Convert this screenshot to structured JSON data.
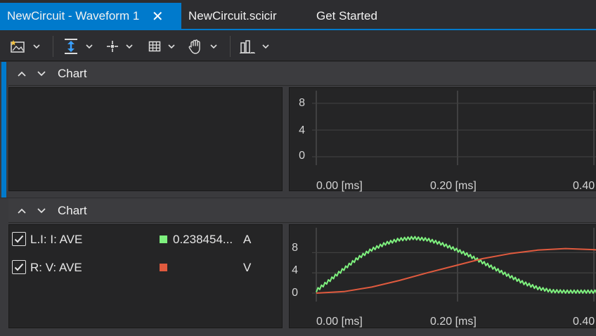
{
  "tabs": [
    {
      "label": "NewCircuit - Waveform 1",
      "active": true,
      "close": "✕"
    },
    {
      "label": "NewCircuit.scicir",
      "active": false
    },
    {
      "label": "Get Started",
      "active": false
    }
  ],
  "toolbar": {
    "icons": [
      "insert-image-icon",
      "fit-vertical-icon",
      "cursor-crosshair-icon",
      "grid-icon",
      "pan-hand-icon",
      "layout-columns-icon"
    ]
  },
  "panels": [
    {
      "title": "Chart",
      "legend": [],
      "chart_data": {
        "type": "line",
        "y_ticks": [
          "8",
          "4",
          "0"
        ],
        "x_ticks": [
          "0.00 [ms]",
          "0.20 [ms]",
          "0.40"
        ],
        "series": []
      }
    },
    {
      "title": "Chart",
      "legend": [
        {
          "name": "L.I: I: AVE",
          "checked": true,
          "color": "#7ef07e",
          "value": "0.238454...",
          "unit": "A"
        },
        {
          "name": "R: V: AVE",
          "checked": true,
          "color": "#e05a3e",
          "value": "",
          "unit": "V"
        }
      ],
      "chart_data": {
        "type": "line",
        "y_ticks": [
          "8",
          "4",
          "0"
        ],
        "x_ticks": [
          "0.00 [ms]",
          "0.20 [ms]",
          "0.40"
        ],
        "x_unit": "ms",
        "series": [
          {
            "name": "L.I: I: AVE",
            "color": "#7ef07e",
            "x": [
              0.0,
              0.02,
              0.04,
              0.06,
              0.08,
              0.1,
              0.12,
              0.14,
              0.16,
              0.18,
              0.2,
              0.22,
              0.24,
              0.26,
              0.28,
              0.3,
              0.32,
              0.34,
              0.36,
              0.38,
              0.4,
              0.42
            ],
            "y": [
              0.5,
              2.6,
              4.8,
              6.9,
              8.6,
              9.8,
              10.6,
              10.9,
              10.6,
              9.8,
              8.7,
              7.5,
              6.1,
              4.7,
              3.3,
              2.0,
              1.0,
              0.4,
              0.3,
              0.3,
              0.3,
              0.3
            ],
            "ripple": 0.6
          },
          {
            "name": "R: V: AVE",
            "color": "#e05a3e",
            "x": [
              0.0,
              0.04,
              0.08,
              0.12,
              0.16,
              0.2,
              0.24,
              0.28,
              0.32,
              0.36,
              0.4,
              0.42
            ],
            "y": [
              0.0,
              0.3,
              1.2,
              2.5,
              4.0,
              5.4,
              6.8,
              7.8,
              8.5,
              8.8,
              8.6,
              8.4
            ]
          }
        ]
      }
    }
  ]
}
